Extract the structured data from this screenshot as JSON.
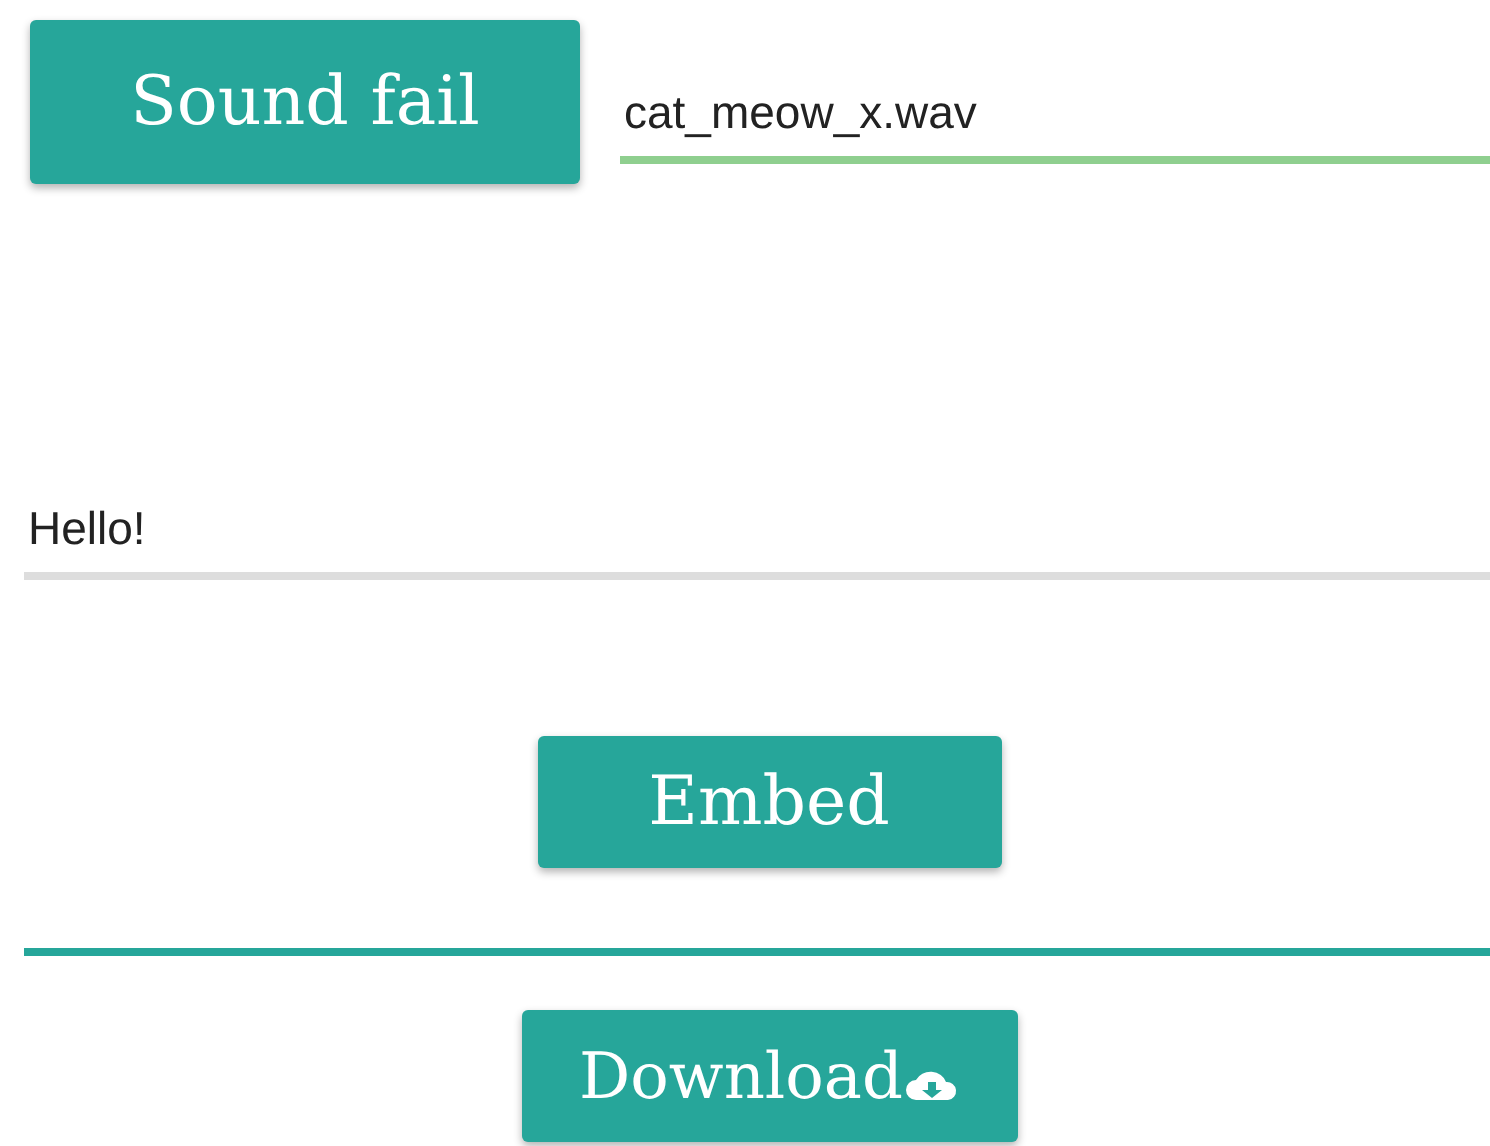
{
  "file_row": {
    "button": "Sound fail",
    "field": {
      "value": "cat_meow_x.wav",
      "focused": true
    }
  },
  "message_field": {
    "value": "Hello!",
    "focused": false
  },
  "embed_button": "Embed",
  "download_button": "Download"
}
